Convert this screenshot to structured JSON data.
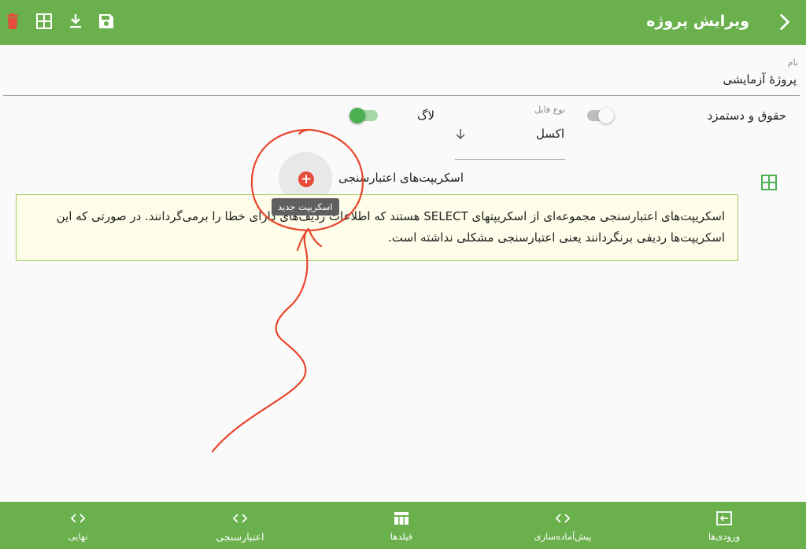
{
  "appbar": {
    "title": "ویرایش پروژه",
    "actions": [
      "back-icon",
      "save-icon",
      "download-icon",
      "grid-icon",
      "delete-icon"
    ]
  },
  "project": {
    "name_label": "نام",
    "name_value": "پروژهٔ آزمایشی"
  },
  "options": {
    "rights_label": "حقوق و دستمزد",
    "rights_enabled": false,
    "file_type_label": "نوع فایل",
    "file_type_value": "اکسل",
    "log_label": "لاگ",
    "log_enabled": true
  },
  "validation": {
    "title": "اسکریپت‌های اعتبارسنجی",
    "add_tooltip": "اسکریپت جدید",
    "info": "اسکریپت‌های اعتبارسنجی مجموعه‌ای از اسکریپتهای SELECT هستند که اطلاعات ردیف‌های دارای خطا را برمی‌گردانند. در صورتی که این اسکریپت‌ها ردیفی برنگردانند یعنی اعتبارسنجی مشکلی نداشته است."
  },
  "bottom_nav": {
    "active": "اعتبارسنجی",
    "items": [
      {
        "label": "ورودی‌ها",
        "icon": "input-icon"
      },
      {
        "label": "پیش‌آماده‌سازی",
        "icon": "code-icon"
      },
      {
        "label": "فیلدها",
        "icon": "table-icon"
      },
      {
        "label": "اعتبارسنجی",
        "icon": "code-icon"
      },
      {
        "label": "نهایی",
        "icon": "code-icon"
      }
    ]
  },
  "colors": {
    "primary": "#6ab04c",
    "delete": "#e74c3c",
    "annotation": "#e8452c",
    "info_bg": "#fdfde9",
    "info_border": "#9ccc65"
  }
}
